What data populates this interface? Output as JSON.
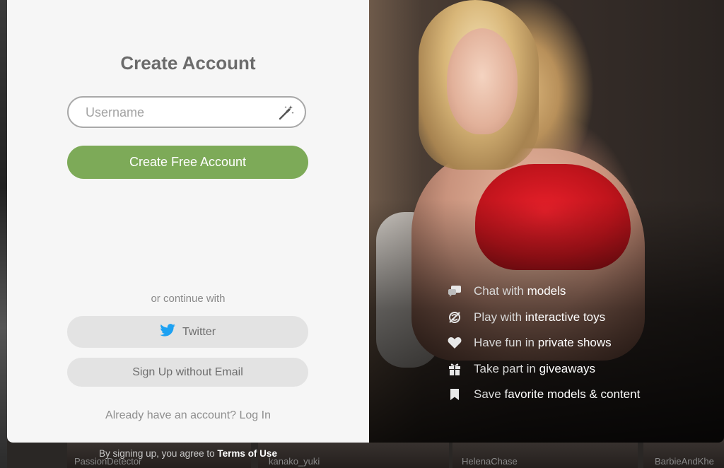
{
  "modal": {
    "title": "Create Account",
    "username": {
      "value": "",
      "placeholder": "Username"
    },
    "create_button_label": "Create Free Account",
    "or_continue_label": "or continue with",
    "twitter_button_label": "Twitter",
    "no_email_button_label": "Sign Up without Email",
    "login_prompt": "Already have an account?",
    "login_link_label": "Log In"
  },
  "features": [
    {
      "icon": "chat-icon",
      "pre": "Chat with ",
      "highlight": "models",
      "post": ""
    },
    {
      "icon": "toy-icon",
      "pre": "Play with ",
      "highlight": "interactive toys",
      "post": ""
    },
    {
      "icon": "heart-icon",
      "pre": "Have fun in ",
      "highlight": "private shows",
      "post": ""
    },
    {
      "icon": "gift-icon",
      "pre": "Take part in ",
      "highlight": "giveaways",
      "post": ""
    },
    {
      "icon": "bookmark-icon",
      "pre": "Save ",
      "highlight": "favorite models & content",
      "post": ""
    }
  ],
  "terms": {
    "text": "By signing up, you agree to",
    "link_label": "Terms of Use"
  },
  "background": {
    "model_names": [
      "PassionDetector",
      "kanako_yuki",
      "HelenaChase",
      "BarbieAndKhe"
    ]
  },
  "colors": {
    "accent_green": "#7daa58",
    "panel_bg": "#f6f6f6",
    "twitter_blue": "#1da1f2"
  }
}
